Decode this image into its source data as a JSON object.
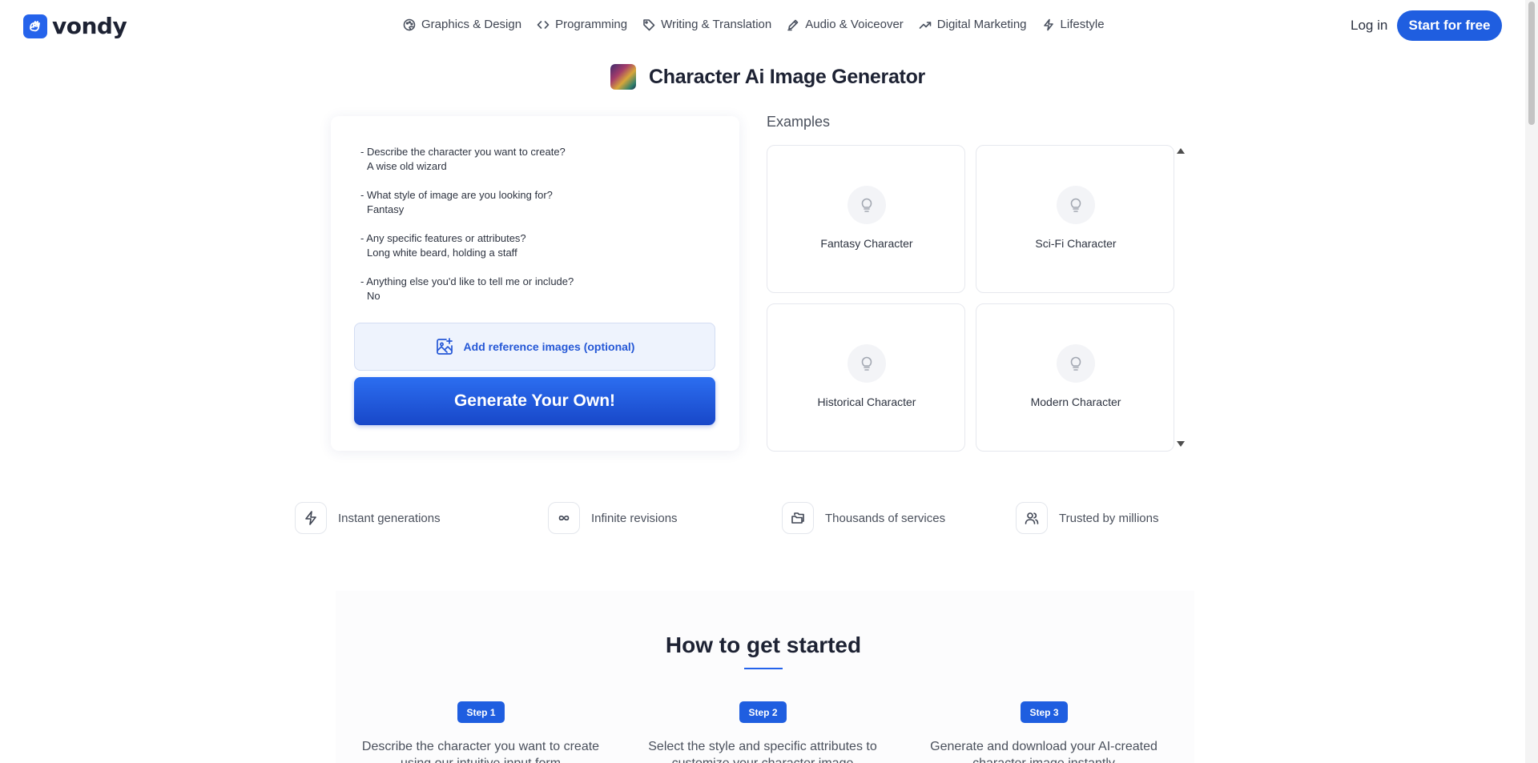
{
  "header": {
    "logo_text": "vondy",
    "nav": [
      {
        "label": "Graphics & Design",
        "icon": "palette-icon"
      },
      {
        "label": "Programming",
        "icon": "code-icon"
      },
      {
        "label": "Writing & Translation",
        "icon": "tag-icon"
      },
      {
        "label": "Audio & Voiceover",
        "icon": "pen-icon"
      },
      {
        "label": "Digital Marketing",
        "icon": "trending-up-icon"
      },
      {
        "label": "Lifestyle",
        "icon": "bolt-icon"
      }
    ],
    "login_label": "Log in",
    "start_label": "Start for free"
  },
  "page": {
    "title": "Character Ai Image Generator"
  },
  "form": {
    "items": [
      {
        "question": "- Describe the character you want to create?",
        "answer": "A wise old wizard"
      },
      {
        "question": "- What style of image are you looking for?",
        "answer": "Fantasy"
      },
      {
        "question": "- Any specific features or attributes?",
        "answer": "Long white beard, holding a staff"
      },
      {
        "question": "- Anything else you'd like to tell me or include?",
        "answer": "No"
      }
    ],
    "reference_label": "Add reference images (optional)",
    "generate_label": "Generate Your Own!"
  },
  "examples": {
    "heading": "Examples",
    "cards": [
      {
        "label": "Fantasy Character",
        "icon": "lightbulb-icon"
      },
      {
        "label": "Sci-Fi Character",
        "icon": "lightbulb-icon"
      },
      {
        "label": "Historical Character",
        "icon": "lightbulb-icon"
      },
      {
        "label": "Modern Character",
        "icon": "lightbulb-icon"
      }
    ]
  },
  "features": [
    {
      "label": "Instant generations",
      "icon": "bolt-icon"
    },
    {
      "label": "Infinite revisions",
      "icon": "infinity-icon"
    },
    {
      "label": "Thousands of services",
      "icon": "folders-icon"
    },
    {
      "label": "Trusted by millions",
      "icon": "users-icon"
    }
  ],
  "howto": {
    "title": "How to get started",
    "steps": [
      {
        "badge": "Step 1",
        "text": "Describe the character you want to create using our intuitive input form"
      },
      {
        "badge": "Step 2",
        "text": "Select the style and specific attributes to customize your character image"
      },
      {
        "badge": "Step 3",
        "text": "Generate and download your AI-created character image instantly"
      }
    ]
  },
  "colors": {
    "accent": "#1f5ee0",
    "link": "#2457d6"
  }
}
